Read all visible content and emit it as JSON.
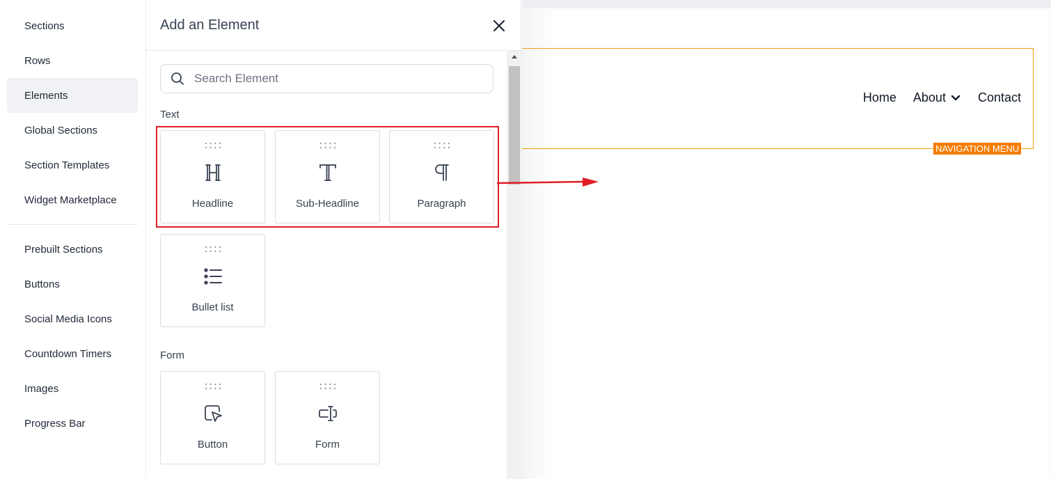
{
  "sidebar": {
    "items": [
      {
        "label": "Sections"
      },
      {
        "label": "Rows"
      },
      {
        "label": "Elements"
      },
      {
        "label": "Global Sections"
      },
      {
        "label": "Section Templates"
      },
      {
        "label": "Widget Marketplace"
      },
      {
        "label": "Prebuilt Sections"
      },
      {
        "label": "Buttons"
      },
      {
        "label": "Social Media Icons"
      },
      {
        "label": "Countdown Timers"
      },
      {
        "label": "Images"
      },
      {
        "label": "Progress Bar"
      }
    ],
    "active": "Elements"
  },
  "panel": {
    "title": "Add an Element",
    "close_icon": "close-icon",
    "search": {
      "placeholder": "Search Element",
      "value": ""
    },
    "categories": [
      {
        "label": "Text",
        "elements": [
          {
            "label": "Headline",
            "icon": "headline-icon"
          },
          {
            "label": "Sub-Headline",
            "icon": "sub-headline-icon"
          },
          {
            "label": "Paragraph",
            "icon": "paragraph-icon"
          },
          {
            "label": "Bullet list",
            "icon": "bullet-list-icon"
          }
        ]
      },
      {
        "label": "Form",
        "elements": [
          {
            "label": "Button",
            "icon": "button-icon"
          },
          {
            "label": "Form",
            "icon": "form-icon"
          }
        ]
      }
    ]
  },
  "canvas": {
    "nav": {
      "links": [
        {
          "label": "Home"
        },
        {
          "label": "About",
          "icon": "chevron-down-icon"
        },
        {
          "label": "Contact"
        }
      ],
      "badge": "NAVIGATION MENU"
    }
  },
  "colors": {
    "highlight": "#e11d26",
    "nav_border": "#f59e0b",
    "badge_bg": "#f57c00",
    "active_bg": "#f1f2f5"
  }
}
